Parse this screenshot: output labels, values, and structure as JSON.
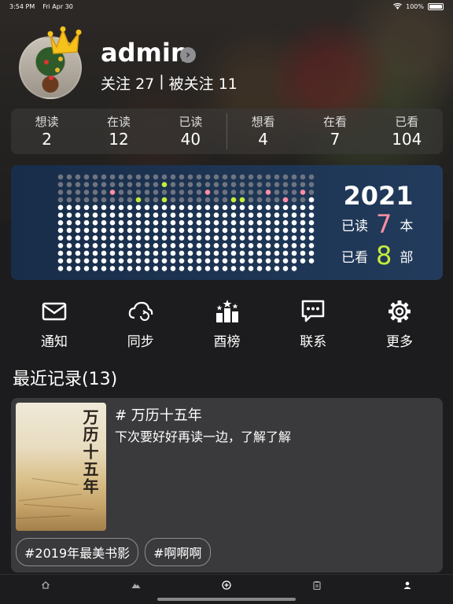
{
  "status_bar": {
    "time": "3:54 PM",
    "date": "Fri Apr 30",
    "battery": "100%"
  },
  "profile": {
    "username": "admin",
    "following_label": "关注",
    "following_count": "27",
    "separator": "|",
    "followers_label": "被关注",
    "followers_count": "11"
  },
  "stats": [
    {
      "label": "想读",
      "value": "2"
    },
    {
      "label": "在读",
      "value": "12"
    },
    {
      "label": "已读",
      "value": "40"
    },
    {
      "label": "想看",
      "value": "4"
    },
    {
      "label": "在看",
      "value": "7"
    },
    {
      "label": "已看",
      "value": "104"
    }
  ],
  "year_summary": {
    "year": "2021",
    "read_prefix": "已读",
    "read_count": "7",
    "read_unit": "本",
    "watched_prefix": "已看",
    "watched_count": "8",
    "watched_unit": "部",
    "dot_colors": {
      "past": "#ffffff",
      "future": "#6e7480",
      "read": "#ff8fa3",
      "watched": "#c6ec3a"
    }
  },
  "actions": [
    {
      "label": "通知",
      "icon": "mail-icon"
    },
    {
      "label": "同步",
      "icon": "cloud-sync-icon"
    },
    {
      "label": "酉榜",
      "icon": "ranking-icon"
    },
    {
      "label": "联系",
      "icon": "chat-icon"
    },
    {
      "label": "更多",
      "icon": "gear-icon"
    }
  ],
  "recent": {
    "title": "最近记录(13)",
    "record": {
      "title": "# 万历十五年",
      "note": "下次要好好再读一边，了解了解",
      "cover_title": "万历十五年",
      "tags": [
        "#2019年最美书影",
        "#啊啊啊"
      ]
    }
  },
  "tab_bar": [
    "home-icon",
    "mountain-icon",
    "add-circle-icon",
    "clipboard-icon",
    "person-icon"
  ]
}
